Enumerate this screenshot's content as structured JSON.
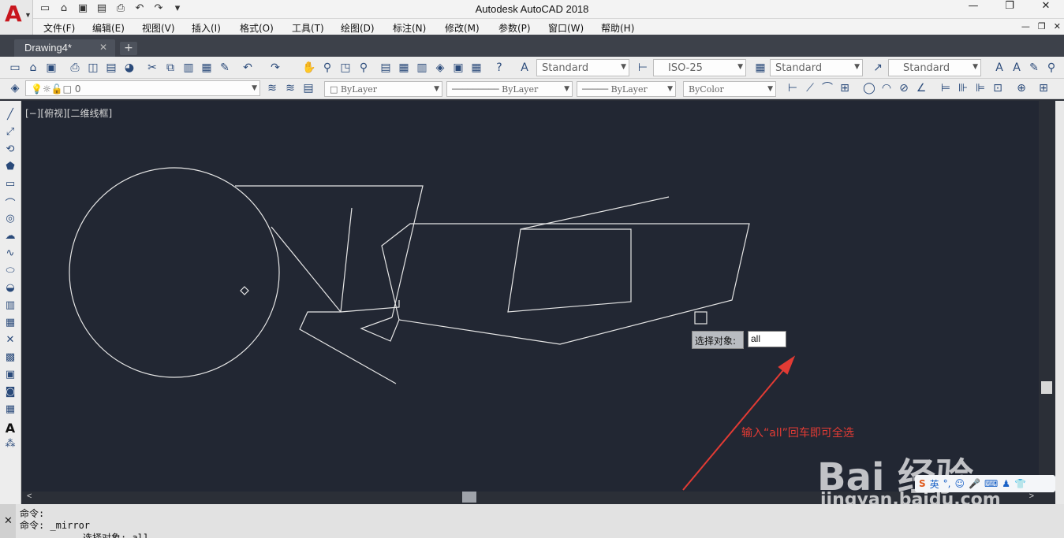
{
  "app": {
    "title": "Autodesk AutoCAD 2018",
    "logo_letter": "A",
    "window_controls": [
      "—",
      "❐",
      "✕"
    ],
    "mdi_controls": [
      "—",
      "❐",
      "✕"
    ]
  },
  "quick_access": [
    "new-icon",
    "open-icon",
    "save-icon",
    "saveas-icon",
    "plot-icon",
    "undo-icon",
    "redo-icon",
    "customize-icon"
  ],
  "menu": [
    "文件(F)",
    "编辑(E)",
    "视图(V)",
    "插入(I)",
    "格式(O)",
    "工具(T)",
    "绘图(D)",
    "标注(N)",
    "修改(M)",
    "参数(P)",
    "窗口(W)",
    "帮助(H)"
  ],
  "tabs": {
    "active": "Drawing4*",
    "close": "✕",
    "add": "+"
  },
  "toolbar_standard": {
    "text_style": "Standard",
    "dim_style": "ISO-25",
    "table_style": "Standard",
    "mleader_style": "Standard"
  },
  "toolbar_layers": {
    "layer": "0",
    "color": "ByLayer",
    "linetype": "ByLayer",
    "lineweight": "ByLayer",
    "plot_style": "ByColor"
  },
  "viewport": {
    "label": "[−][俯视][二维线框]",
    "background": "#222733",
    "line_color": "#e6e6e6"
  },
  "dynamic_prompt": {
    "label": "选择对象:",
    "input_value": "all"
  },
  "annotation": {
    "text": "输入“all”回车即可全选",
    "color": "#e23b34"
  },
  "command_window": {
    "lines": [
      "命令:",
      "命令: _mirror",
      "选择对象: all"
    ]
  },
  "watermark": {
    "brand": "Bai  经验",
    "url": "jingyan.baidu.com"
  },
  "ime_bar": {
    "lang": "英"
  }
}
